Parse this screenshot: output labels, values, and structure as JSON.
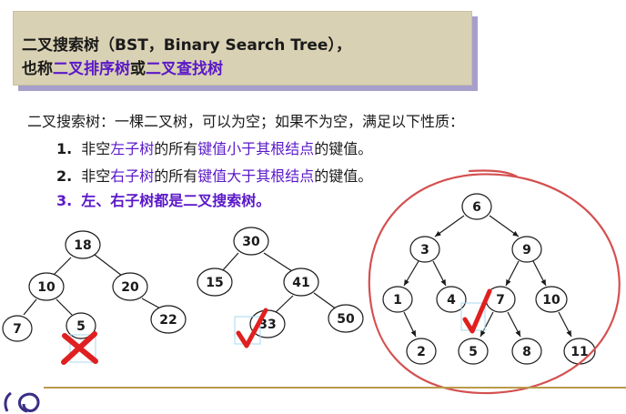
{
  "header": {
    "line1_a": "二叉搜索树（BST，Binary Search Tree），",
    "line2_prefix": "也称",
    "line2_term1": "二叉排序树",
    "line2_or": "或",
    "line2_term2": "二叉查找树"
  },
  "definition": {
    "intro": "二叉搜索树：一棵二叉树，可以为空；如果不为空，满足以下性质：",
    "items": [
      {
        "num": "1.",
        "parts": [
          "非空",
          "左子树",
          "的所有",
          "键值小于其根结点",
          "的键值。"
        ]
      },
      {
        "num": "2.",
        "parts": [
          "非空",
          "右子树",
          "的所有",
          "键值大于其根结点",
          "的键值。"
        ]
      },
      {
        "num": "3.",
        "text": "左、右子树都是二叉搜索树。"
      }
    ]
  },
  "trees": [
    {
      "nodes": [
        "18",
        "10",
        "20",
        "7",
        "5",
        "22"
      ],
      "verdict": "cross"
    },
    {
      "nodes": [
        "30",
        "15",
        "41",
        "33",
        "50"
      ],
      "verdict": "check"
    },
    {
      "nodes": [
        "6",
        "3",
        "9",
        "1",
        "4",
        "7",
        "10",
        "2",
        "5",
        "8",
        "11"
      ],
      "verdict": "check"
    }
  ],
  "colors": {
    "accent_purple": "#5a18c9",
    "cross_red": "#e02020",
    "check_red": "#e02020",
    "circle_red": "#d45050",
    "title_bg": "#d9d1b3",
    "title_shadow": "#a69fcb"
  }
}
